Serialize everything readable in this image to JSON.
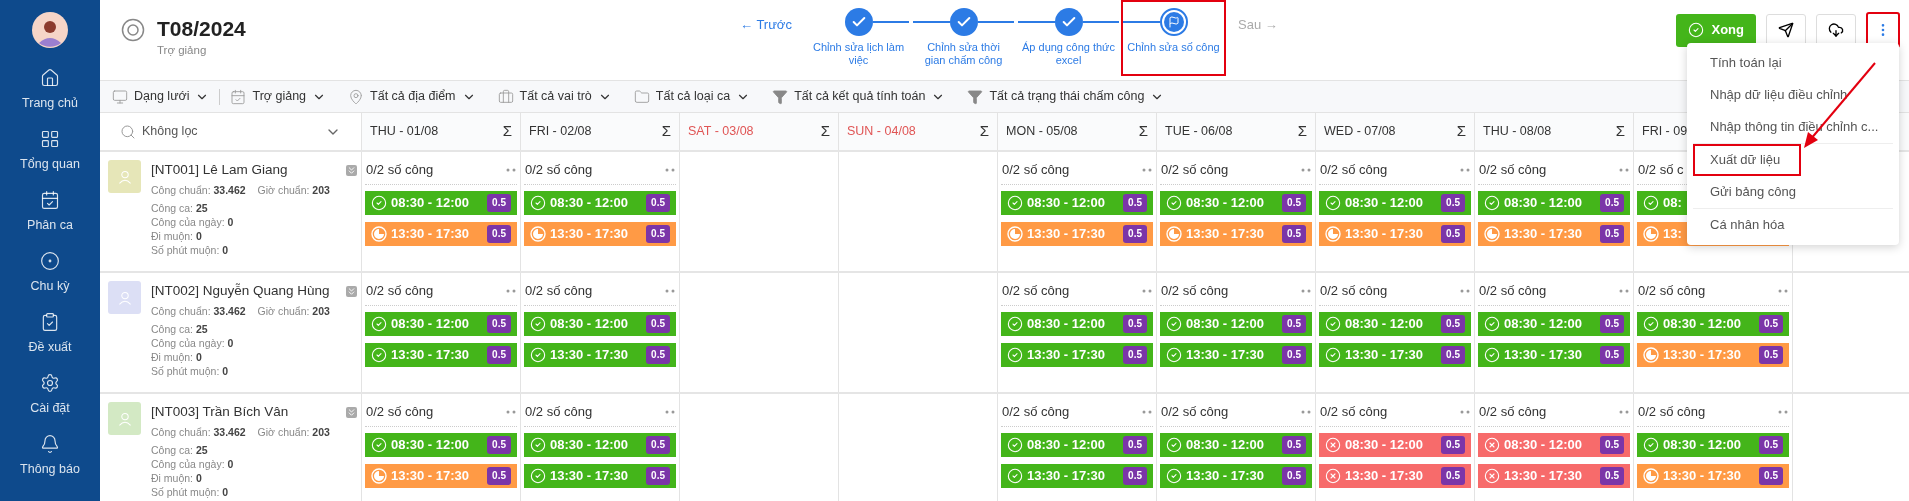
{
  "sidebar": {
    "items": [
      {
        "label": "Trang chủ"
      },
      {
        "label": "Tổng quan"
      },
      {
        "label": "Phân ca"
      },
      {
        "label": "Chu kỳ"
      },
      {
        "label": "Đề xuất"
      },
      {
        "label": "Cài đặt"
      },
      {
        "label": "Thông báo"
      }
    ]
  },
  "header": {
    "title": "T08/2024",
    "subtitle": "Trợ giảng",
    "prev": "← Trước",
    "next": "Sau →",
    "steps": [
      {
        "label": "Chỉnh sửa lịch làm việc",
        "selected": false
      },
      {
        "label": "Chỉnh sửa thời gian chấm công",
        "selected": false
      },
      {
        "label": "Áp dụng công thức excel",
        "selected": false
      },
      {
        "label": "Chỉnh sửa số công",
        "selected": true
      }
    ],
    "done_button": "Xong",
    "more_highlighted": true
  },
  "filters": [
    {
      "label": "Dạng lưới"
    },
    {
      "label": "Trợ giảng"
    },
    {
      "label": "Tất cả địa điểm"
    },
    {
      "label": "Tất cả vai trò"
    },
    {
      "label": "Tất cả loại ca"
    },
    {
      "label": "Tất cả kết quả tính toán"
    },
    {
      "label": "Tất cả trạng thái chấm công"
    }
  ],
  "table": {
    "search": {
      "placeholder": "Không lọc"
    },
    "days": [
      {
        "label": "THU - 01/08",
        "weekend": false,
        "sum": "Σ"
      },
      {
        "label": "FRI - 02/08",
        "weekend": false,
        "sum": "Σ"
      },
      {
        "label": "SAT - 03/08",
        "weekend": true,
        "sum": "Σ"
      },
      {
        "label": "SUN - 04/08",
        "weekend": true,
        "sum": "Σ"
      },
      {
        "label": "MON - 05/08",
        "weekend": false,
        "sum": "Σ"
      },
      {
        "label": "TUE - 06/08",
        "weekend": false,
        "sum": "Σ"
      },
      {
        "label": "WED - 07/08",
        "weekend": false,
        "sum": "Σ"
      },
      {
        "label": "THU - 08/08",
        "weekend": false,
        "sum": "Σ"
      },
      {
        "label": "FRI - 09",
        "weekend": false
      }
    ],
    "rows": [
      {
        "name": "[NT001] Lê Lam Giang",
        "color": "#e6e6b8",
        "stats": [
          [
            "Công chuẩn: **33.462**",
            "Giờ chuẩn: **203**"
          ],
          [
            "Công ca: **25**"
          ],
          [
            "Công của ngày: **0**"
          ],
          [
            "Đi muộn: **0**"
          ],
          [
            "Số phút muộn: **0**"
          ]
        ],
        "cells": [
          {
            "kind": "shifts",
            "summary": "0/2 số công",
            "shifts": [
              {
                "kind": "ok",
                "time": "08:30 - 12:00",
                "badge": "0.5"
              },
              {
                "kind": "partial",
                "time": "13:30 - 17:30",
                "badge": "0.5"
              }
            ]
          },
          {
            "kind": "shifts",
            "summary": "0/2 số công",
            "shifts": [
              {
                "kind": "ok",
                "time": "08:30 - 12:00",
                "badge": "0.5"
              },
              {
                "kind": "partial",
                "time": "13:30 - 17:30",
                "badge": "0.5"
              }
            ]
          },
          {
            "kind": "empty"
          },
          {
            "kind": "empty"
          },
          {
            "kind": "shifts",
            "summary": "0/2 số công",
            "shifts": [
              {
                "kind": "ok",
                "time": "08:30 - 12:00",
                "badge": "0.5"
              },
              {
                "kind": "partial",
                "time": "13:30 - 17:30",
                "badge": "0.5"
              }
            ]
          },
          {
            "kind": "shifts",
            "summary": "0/2 số công",
            "shifts": [
              {
                "kind": "ok",
                "time": "08:30 - 12:00",
                "badge": "0.5"
              },
              {
                "kind": "partial",
                "time": "13:30 - 17:30",
                "badge": "0.5"
              }
            ]
          },
          {
            "kind": "shifts",
            "summary": "0/2 số công",
            "shifts": [
              {
                "kind": "ok",
                "time": "08:30 - 12:00",
                "badge": "0.5"
              },
              {
                "kind": "partial",
                "time": "13:30 - 17:30",
                "badge": "0.5"
              }
            ]
          },
          {
            "kind": "shifts",
            "summary": "0/2 số công",
            "shifts": [
              {
                "kind": "ok",
                "time": "08:30 - 12:00",
                "badge": "0.5"
              },
              {
                "kind": "partial",
                "time": "13:30 - 17:30",
                "badge": "0.5"
              }
            ]
          },
          {
            "kind": "shifts",
            "summary": "0/2 số c",
            "shifts": [
              {
                "kind": "ok",
                "time": "08:"
              },
              {
                "kind": "partial",
                "time": "13:"
              }
            ]
          }
        ]
      },
      {
        "name": "[NT002] Nguyễn Quang Hùng",
        "color": "#dcdff5",
        "stats": [
          [
            "Công chuẩn: **33.462**",
            "Giờ chuẩn: **203**"
          ],
          [
            "Công ca: **25**"
          ],
          [
            "Công của ngày: **0**"
          ],
          [
            "Đi muộn: **0**"
          ],
          [
            "Số phút muộn: **0**"
          ]
        ],
        "cells": [
          {
            "kind": "shifts",
            "summary": "0/2 số công",
            "shifts": [
              {
                "kind": "ok",
                "time": "08:30 - 12:00",
                "badge": "0.5"
              },
              {
                "kind": "ok",
                "time": "13:30 - 17:30",
                "badge": "0.5"
              }
            ]
          },
          {
            "kind": "shifts",
            "summary": "0/2 số công",
            "shifts": [
              {
                "kind": "ok",
                "time": "08:30 - 12:00",
                "badge": "0.5"
              },
              {
                "kind": "ok",
                "time": "13:30 - 17:30",
                "badge": "0.5"
              }
            ]
          },
          {
            "kind": "empty"
          },
          {
            "kind": "empty"
          },
          {
            "kind": "shifts",
            "summary": "0/2 số công",
            "shifts": [
              {
                "kind": "ok",
                "time": "08:30 - 12:00",
                "badge": "0.5"
              },
              {
                "kind": "ok",
                "time": "13:30 - 17:30",
                "badge": "0.5"
              }
            ]
          },
          {
            "kind": "shifts",
            "summary": "0/2 số công",
            "shifts": [
              {
                "kind": "ok",
                "time": "08:30 - 12:00",
                "badge": "0.5"
              },
              {
                "kind": "ok",
                "time": "13:30 - 17:30",
                "badge": "0.5"
              }
            ]
          },
          {
            "kind": "shifts",
            "summary": "0/2 số công",
            "shifts": [
              {
                "kind": "ok",
                "time": "08:30 - 12:00",
                "badge": "0.5"
              },
              {
                "kind": "ok",
                "time": "13:30 - 17:30",
                "badge": "0.5"
              }
            ]
          },
          {
            "kind": "shifts",
            "summary": "0/2 số công",
            "shifts": [
              {
                "kind": "ok",
                "time": "08:30 - 12:00",
                "badge": "0.5"
              },
              {
                "kind": "ok",
                "time": "13:30 - 17:30",
                "badge": "0.5"
              }
            ]
          },
          {
            "kind": "shifts",
            "summary": "0/2 số công",
            "shifts": [
              {
                "kind": "ok",
                "time": "08:30 - 12:00",
                "badge": "0.5"
              },
              {
                "kind": "partial",
                "time": "13:30 - 17:30",
                "badge": "0.5"
              }
            ]
          }
        ]
      },
      {
        "name": "[NT003] Trần Bích Vân",
        "color": "#d3e9c4",
        "stats": [
          [
            "Công chuẩn: **33.462**",
            "Giờ chuẩn: **203**"
          ],
          [
            "Công ca: **25**"
          ],
          [
            "Công của ngày: **0**"
          ],
          [
            "Đi muộn: **0**"
          ],
          [
            "Số phút muộn: **0**"
          ]
        ],
        "cells": [
          {
            "kind": "shifts",
            "summary": "0/2 số công",
            "shifts": [
              {
                "kind": "ok",
                "time": "08:30 - 12:00",
                "badge": "0.5"
              },
              {
                "kind": "partial",
                "time": "13:30 - 17:30",
                "badge": "0.5"
              }
            ]
          },
          {
            "kind": "shifts",
            "summary": "0/2 số công",
            "shifts": [
              {
                "kind": "ok",
                "time": "08:30 - 12:00",
                "badge": "0.5"
              },
              {
                "kind": "ok",
                "time": "13:30 - 17:30",
                "badge": "0.5"
              }
            ]
          },
          {
            "kind": "empty"
          },
          {
            "kind": "empty"
          },
          {
            "kind": "shifts",
            "summary": "0/2 số công",
            "shifts": [
              {
                "kind": "ok",
                "time": "08:30 - 12:00",
                "badge": "0.5"
              },
              {
                "kind": "ok",
                "time": "13:30 - 17:30",
                "badge": "0.5"
              }
            ]
          },
          {
            "kind": "shifts",
            "summary": "0/2 số công",
            "shifts": [
              {
                "kind": "ok",
                "time": "08:30 - 12:00",
                "badge": "0.5"
              },
              {
                "kind": "ok",
                "time": "13:30 - 17:30",
                "badge": "0.5"
              }
            ]
          },
          {
            "kind": "shifts",
            "summary": "0/2 số công",
            "shifts": [
              {
                "kind": "missed",
                "time": "08:30 - 12:00",
                "badge": "0.5"
              },
              {
                "kind": "missed",
                "time": "13:30 - 17:30",
                "badge": "0.5"
              }
            ]
          },
          {
            "kind": "shifts",
            "summary": "0/2 số công",
            "shifts": [
              {
                "kind": "missed",
                "time": "08:30 - 12:00",
                "badge": "0.5"
              },
              {
                "kind": "missed",
                "time": "13:30 - 17:30",
                "badge": "0.5"
              }
            ]
          },
          {
            "kind": "shifts",
            "summary": "0/2 số công",
            "shifts": [
              {
                "kind": "ok",
                "time": "08:30 - 12:00",
                "badge": "0.5"
              },
              {
                "kind": "partial",
                "time": "13:30 - 17:30",
                "badge": "0.5"
              }
            ]
          }
        ]
      }
    ]
  },
  "menu": {
    "annotation_arrow": true,
    "sections": [
      {
        "items": [
          {
            "label": "Tính toán lại",
            "highlighted": false
          },
          {
            "label": "Nhập dữ liệu điều chỉnh",
            "highlighted": false
          },
          {
            "label": "Nhập thông tin điều chỉnh c...",
            "highlighted": false
          }
        ]
      },
      {
        "items": [
          {
            "label": "Xuất dữ liệu",
            "highlighted": true
          },
          {
            "label": "Gửi bảng công",
            "highlighted": false
          }
        ]
      },
      {
        "items": [
          {
            "label": "Cá nhân hóa",
            "highlighted": false
          }
        ]
      }
    ]
  }
}
